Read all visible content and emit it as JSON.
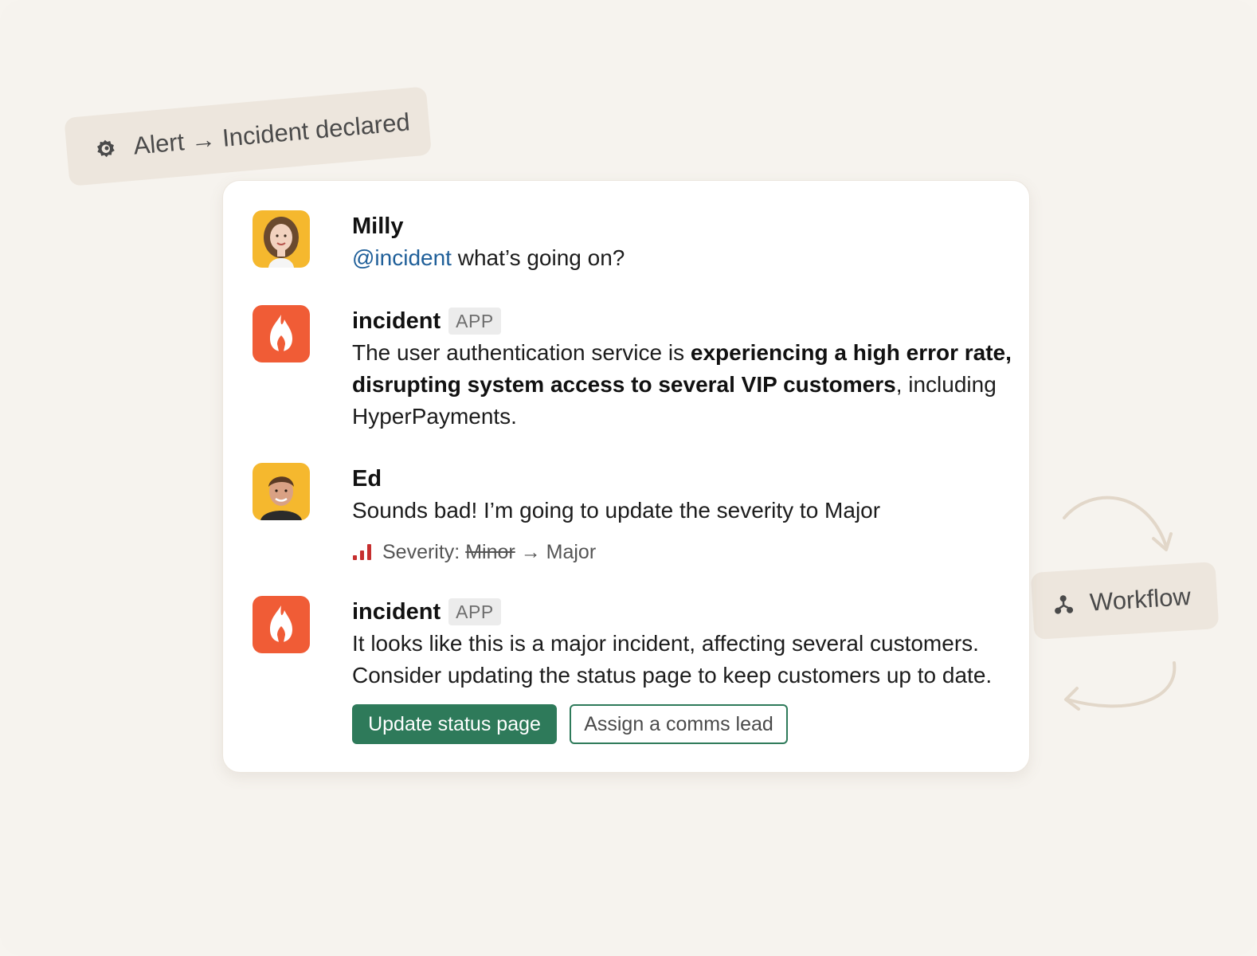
{
  "tags": {
    "alert": {
      "icon": "grafana-icon",
      "label": "Alert → Incident declared"
    },
    "workflow": {
      "icon": "workflow-icon",
      "label": "Workflow"
    }
  },
  "messages": [
    {
      "author": "Milly",
      "avatar": "milly-avatar",
      "mention": "@incident",
      "text": " what’s going on?"
    },
    {
      "author": "incident",
      "badge": "APP",
      "avatar": "incident-app-icon",
      "parts": [
        "The user authentication service is ",
        "experiencing a high error rate,",
        " ",
        "disrupting system access to several VIP customers",
        ", including HyperPayments."
      ]
    },
    {
      "author": "Ed",
      "avatar": "ed-avatar",
      "text": "Sounds bad! I’m going to update the severity to Major",
      "severity": {
        "label": "Severity:",
        "from": "Minor",
        "arrow": "→",
        "to": "Major",
        "icon": "severity-bars-icon"
      }
    },
    {
      "author": "incident",
      "badge": "APP",
      "avatar": "incident-app-icon",
      "text": "It looks like this is a major incident, affecting several customers. Consider updating the status page to keep customers up to date.",
      "buttons": {
        "primary": "Update status page",
        "secondary": "Assign a comms lead"
      }
    }
  ],
  "colors": {
    "background": "#f6f3ee",
    "tag_bg": "#ede6dd",
    "brand_red": "#f05c36",
    "button_green": "#2e7a5a",
    "mention_blue": "#1f5f99",
    "severity_red": "#c62f2f"
  }
}
